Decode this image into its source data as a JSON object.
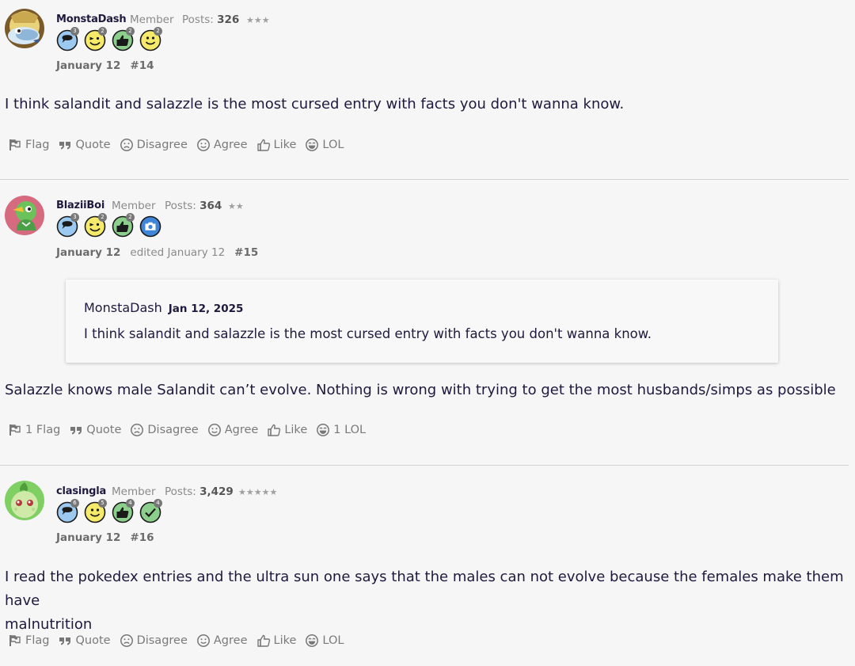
{
  "posts": [
    {
      "username": "MonstaDash",
      "role": "Member",
      "posts_label": "Posts:",
      "posts_count": "326",
      "stars": "★★★",
      "badge_counts": [
        "3",
        "2",
        "2",
        "2"
      ],
      "date": "January 12",
      "edited": "",
      "number": "#14",
      "body": "I think salandit and salazzle is the most cursed entry with facts you don't wanna know.",
      "actions": {
        "flag": "Flag",
        "quote": "Quote",
        "disagree": "Disagree",
        "agree": "Agree",
        "like": "Like",
        "lol": "LOL"
      }
    },
    {
      "username": "BlaziiBoi",
      "role": "Member",
      "posts_label": "Posts:",
      "posts_count": "364",
      "stars": "★★",
      "badge_counts": [
        "3",
        "2",
        "2"
      ],
      "date": "January 12",
      "edited": "edited January 12",
      "number": "#15",
      "quote": {
        "author": "MonstaDash",
        "date": "Jan 12, 2025",
        "text": "I think salandit and salazzle is the most cursed entry with facts you don't wanna know."
      },
      "body": "Salazzle knows male Salandit can’t evolve. Nothing is wrong with trying to get the most husbands/simps as possible",
      "actions": {
        "flag": "1 Flag",
        "quote": "Quote",
        "disagree": "Disagree",
        "agree": "Agree",
        "like": "Like",
        "lol": "1 LOL"
      }
    },
    {
      "username": "clasingla",
      "role": "Member",
      "posts_label": "Posts:",
      "posts_count": "3,429",
      "stars": "★★★★★",
      "badge_counts": [
        "6",
        "5",
        "4",
        "4"
      ],
      "date": "January 12",
      "edited": "",
      "number": "#16",
      "body_line1": "I read the pokedex entries and the ultra sun one says that the males can not evolve because the females make them have",
      "body_line2": "malnutrition",
      "actions": {
        "flag": "Flag",
        "quote": "Quote",
        "disagree": "Disagree",
        "agree": "Agree",
        "like": "Like",
        "lol": "LOL"
      }
    }
  ],
  "icons": {
    "flag": "flag-icon",
    "quote": "quote-icon",
    "disagree": "frown-icon",
    "agree": "smile-icon",
    "like": "thumbs-up-icon",
    "lol": "laugh-icon"
  },
  "colors": {
    "text": "#1f1a3d",
    "muted": "#8a8a8a",
    "badge_blue": "#9cc9f0",
    "badge_yellow": "#f5ea6a",
    "badge_green": "#8ccf8c",
    "camera_badge": "#3f86d8"
  }
}
